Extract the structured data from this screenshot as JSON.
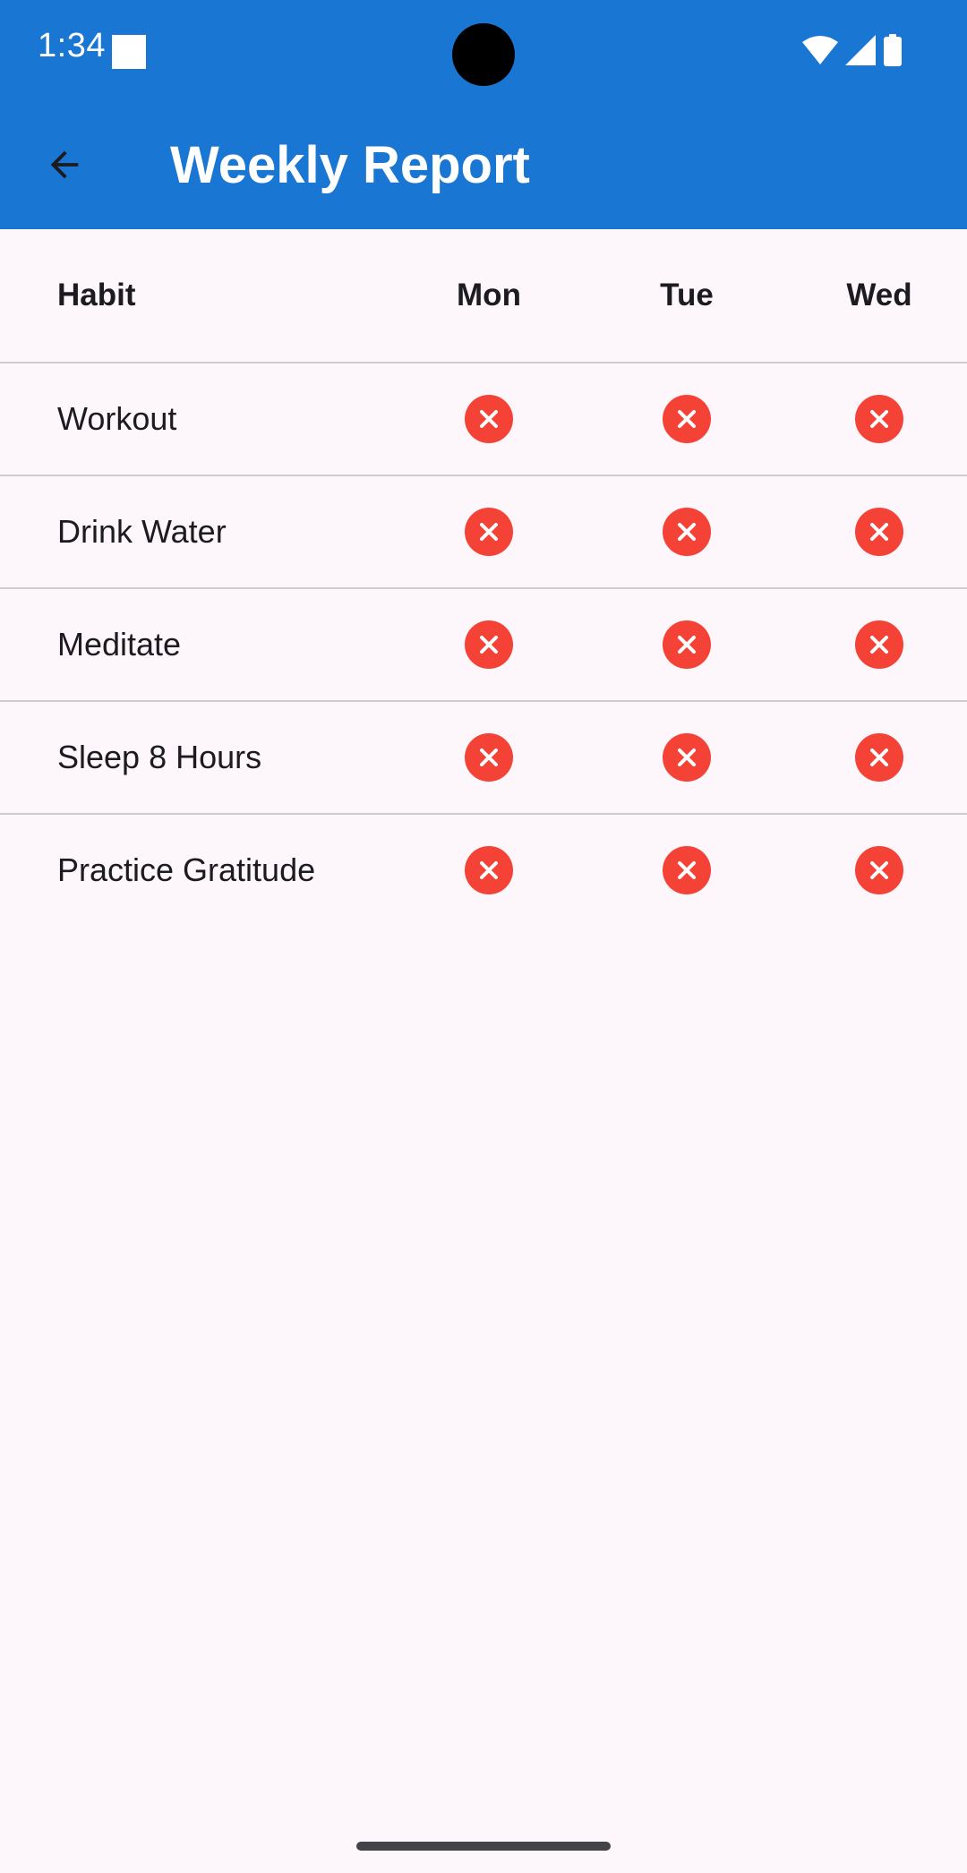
{
  "status_bar": {
    "time": "1:34"
  },
  "toolbar": {
    "back_icon": "arrow-back-icon",
    "title": "Weekly Report"
  },
  "table": {
    "headers": {
      "habit": "Habit",
      "days": [
        "Mon",
        "Tue",
        "Wed"
      ]
    },
    "rows": [
      {
        "habit": "Workout",
        "statuses": [
          "missed",
          "missed",
          "missed"
        ]
      },
      {
        "habit": "Drink Water",
        "statuses": [
          "missed",
          "missed",
          "missed"
        ]
      },
      {
        "habit": "Meditate",
        "statuses": [
          "missed",
          "missed",
          "missed"
        ]
      },
      {
        "habit": "Sleep 8 Hours",
        "statuses": [
          "missed",
          "missed",
          "missed"
        ]
      },
      {
        "habit": "Practice Gratitude",
        "statuses": [
          "missed",
          "missed",
          "missed"
        ]
      }
    ],
    "status_icon": "cancel-circle-icon"
  },
  "colors": {
    "app_bar": "#1976d2",
    "background": "#fdf6fb",
    "missed": "#f44336",
    "divider": "#cfcbd0"
  }
}
